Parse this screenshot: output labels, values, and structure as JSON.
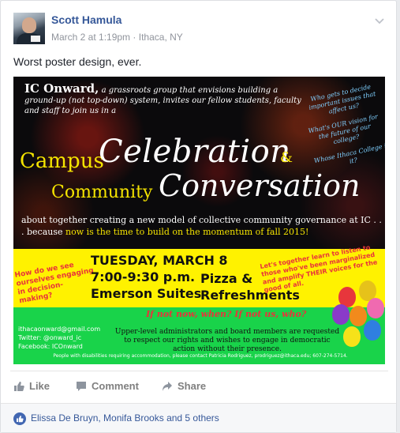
{
  "post": {
    "author": "Scott Hamula",
    "date": "March 2 at 1:19pm",
    "separator": "·",
    "location": "Ithaca, NY",
    "text": "Worst poster design, ever."
  },
  "poster": {
    "brand": "IC Onward,",
    "intro": " a grassroots group that envisions building a ground-up (not top-down) system, invites our fellow students, faculty and staff to join us in a",
    "question_1": "Who gets to decide important issues that affect us?",
    "question_2": "What's OUR vision for the future of our college?",
    "question_3": "Whose Ithaca College is it?",
    "campus": "Campus",
    "celebration": "Celebration",
    "amp": "&",
    "community": "Community",
    "conversation": "Conversation",
    "about": "about together creating a new model of collective community governance at IC . . . because ",
    "about_highlight": "now is the time to build on the momentum of fall 2015!",
    "how": "How do we see ourselves engaging in decision-making?",
    "date_line": "TUESDAY, MARCH 8",
    "time_line": "7:00-9:30 p.m.",
    "place_line": "Emerson Suites",
    "pizza_line_1": "Pizza &",
    "pizza_line_2": "Refreshments",
    "lets": "Let's together learn to listen to those who've been marginalized and amplify THEIR voices for the good of all.",
    "if_not": "If not now, when? If not us, who?",
    "email": "ithacaonward@gmail.com",
    "twitter": "Twitter: @onward_ic",
    "facebook": "Facebook: ICOnward",
    "upper": "Upper-level administrators and board members are requested to respect our rights and wishes to engage in democratic action without their presence.",
    "accessibility": "People with disabilities requiring accommodation, please contact Patricia Rodriguez, prodriguez@ithaca.edu; 607-274-5714."
  },
  "actions": {
    "like": "Like",
    "comment": "Comment",
    "share": "Share"
  },
  "likes": {
    "text": "Elissa De Bruyn, Monifa Brooks and 5 others"
  },
  "colors": {
    "link": "#365899",
    "like_badge": "#4267b2",
    "poster_yellow": "#fff200",
    "poster_green": "#19d34a"
  },
  "icons": [
    "avatar",
    "chevron-down-icon",
    "like-icon",
    "comment-icon",
    "share-icon",
    "like-badge-icon"
  ]
}
